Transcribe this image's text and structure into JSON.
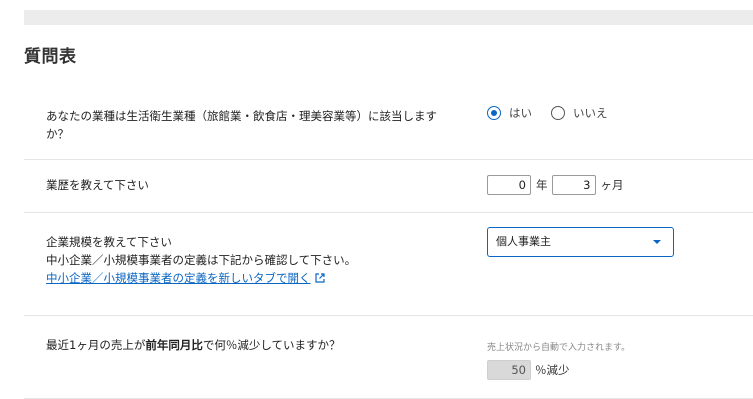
{
  "page": {
    "title": "質問表"
  },
  "q1": {
    "question": "あなたの業種は生活衛生業種（旅館業・飲食店・理美容業等）に該当しますか？",
    "options": [
      {
        "label": "はい",
        "checked": true
      },
      {
        "label": "いいえ",
        "checked": false
      }
    ]
  },
  "q2": {
    "question": "業歴を教えて下さい",
    "years_value": "0",
    "years_unit": "年",
    "months_value": "3",
    "months_unit": "ヶ月"
  },
  "q3": {
    "question_line1": "企業規模を教えて下さい",
    "question_line2": "中小企業／小規模事業者の定義は下記から確認して下さい。",
    "link_text": "中小企業／小規模事業者の定義を新しいタブで開く",
    "selected": "個人事業主"
  },
  "q4": {
    "question_pre": "最近1ヶ月の売上が",
    "question_bold": "前年同月比",
    "question_post": "で何％減少していますか？",
    "note": "売上状況から自動で入力されます。",
    "value": "50",
    "unit": "％減少"
  },
  "colors": {
    "accent": "#0a66c2",
    "divider": "#e6e6e6",
    "readonly_bg": "#d9d9d9"
  }
}
